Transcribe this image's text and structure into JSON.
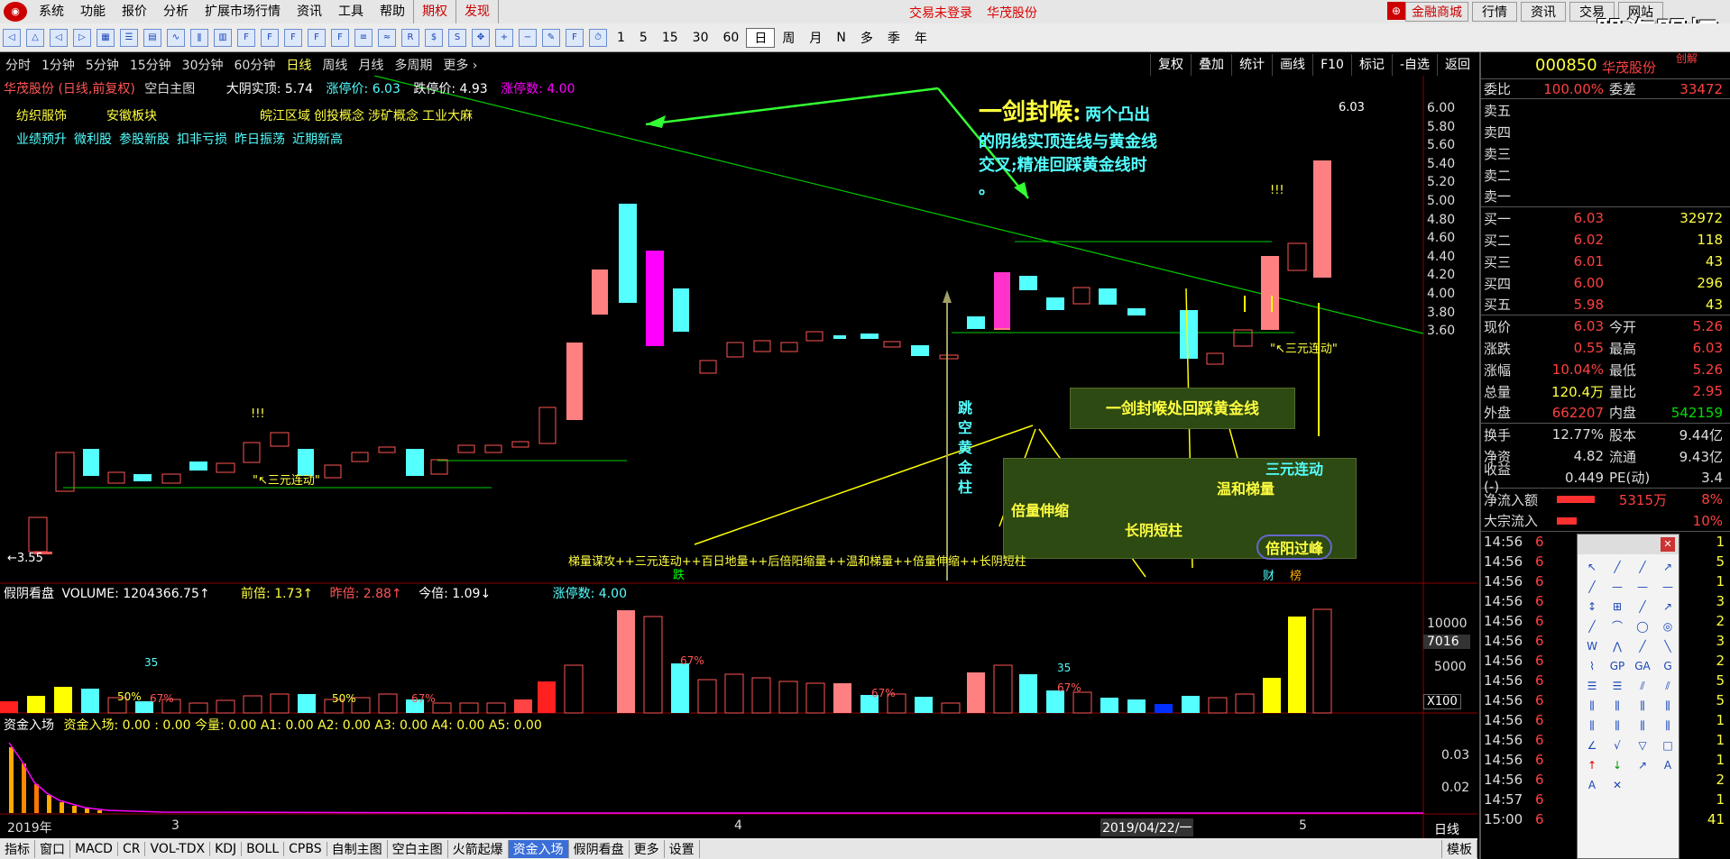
{
  "menu": {
    "items": [
      "系统",
      "功能",
      "报价",
      "分析",
      "扩展市场行情",
      "资讯",
      "工具",
      "帮助"
    ],
    "qiquan": "期权",
    "faxian": "发现",
    "status": "交易未登录",
    "stock": "华茂股份",
    "right": [
      "金融商城",
      "行情",
      "资讯",
      "交易",
      "网站"
    ],
    "watermark": "股海明灯"
  },
  "toolbar": {
    "nums": [
      "1",
      "5",
      "15",
      "30",
      "60"
    ],
    "periods": [
      "日",
      "周",
      "月",
      "N",
      "多",
      "季",
      "年"
    ]
  },
  "periodbar": {
    "items": [
      "分时",
      "1分钟",
      "5分钟",
      "15分钟",
      "30分钟",
      "60分钟",
      "日线",
      "周线",
      "月线",
      "多周期",
      "更多 ›"
    ],
    "right": [
      "复权",
      "叠加",
      "统计",
      "画线",
      "F10",
      "标记",
      "-自选",
      "返回"
    ]
  },
  "chart": {
    "title": "华茂股份 (日线,前复权)",
    "subtitle": "空白主图",
    "line2": "大阴实顶: 5.74",
    "zt": "涨停价: 6.03",
    "dt": "跌停价: 4.93",
    "ztcount": "涨停数: 4.00",
    "tags1": [
      "纺织服饰",
      "安徽板块",
      "皖江区域",
      "创投概念",
      "涉矿概念",
      "工业大麻"
    ],
    "tags2": [
      "业绩预升",
      "微利股",
      "参股新股",
      "扣非亏损",
      "昨日振荡",
      "近期新高"
    ],
    "ylabels": [
      "6.00",
      "5.80",
      "5.60",
      "5.40",
      "5.20",
      "5.00",
      "4.80",
      "4.60",
      "4.40",
      "4.20",
      "4.00",
      "3.80",
      "3.60"
    ],
    "low": "←3.55",
    "high": "6.03",
    "annot_title": "一剑封喉:",
    "annot_body1": "两个凸出",
    "annot_body2": "的阴线实顶连线与黄金线",
    "annot_body3": "交叉;精准回踩黄金线时",
    "annot_body4": "。",
    "box1": "一剑封喉处回踩黄金线",
    "box2_a": "倍量伸缩",
    "box2_b": "长阴短柱",
    "box2_c": "温和梯量",
    "box2_d": "三元连动",
    "box2_e": "倍阳过峰",
    "vert": "跳空黄金柱",
    "sanyuan": "\"↖三元连动\"",
    "sanyuan2": "\"↖三元连动\"",
    "bottomtext": "梯量谋攻++三元连动++百日地量++后倍阳缩量++温和梯量++倍量伸缩++长阴短柱",
    "die": "跌",
    "cai": "财",
    "bang": "榜",
    "exclaim": "!!!"
  },
  "volume": {
    "title": "假阴看盘",
    "label": "VOLUME: 1204366.75↑",
    "qb": "前倍: 1.73↑",
    "zb": "昨倍: 2.88↑",
    "jb": "今倍: 1.09↓",
    "ztcount": "涨停数: 4.00",
    "y1": "10000",
    "y2": "7016",
    "y3": "5000",
    "unit": "X100",
    "marks": [
      "35",
      "50%",
      "67%",
      "50%",
      "67%",
      "67%",
      "35",
      "67%",
      "67%"
    ]
  },
  "fund": {
    "title": "资金入场",
    "line": "资金入场: 0.00 : 0.00 今量: 0.00 A1: 0.00 A2: 0.00 A3: 0.00 A4: 0.00 A5: 0.00",
    "y1": "0.03",
    "y2": "0.02",
    "xlabels": [
      "2019年",
      "3",
      "4",
      "2019/04/22/一",
      "5"
    ],
    "dayline": "日线"
  },
  "bottom": {
    "tabs": [
      "指标",
      "窗口",
      "MACD",
      "CR",
      "VOL-TDX",
      "KDJ",
      "BOLL",
      "CPBS",
      "自制主图",
      "空白主图",
      "火箭起爆",
      "资金入场",
      "假阴看盘",
      "更多",
      "设置"
    ],
    "right": "模板"
  },
  "side": {
    "code": "000850",
    "name": "华茂股份",
    "tag": "创解",
    "weibi": "委比",
    "weibi_v": "100.00%",
    "weicha": "委差",
    "weicha_v": "33472",
    "sells": [
      "卖五",
      "卖四",
      "卖三",
      "卖二",
      "卖一"
    ],
    "buys": [
      [
        "买一",
        "6.03",
        "32972"
      ],
      [
        "买二",
        "6.02",
        "118"
      ],
      [
        "买三",
        "6.01",
        "43"
      ],
      [
        "买四",
        "6.00",
        "296"
      ],
      [
        "买五",
        "5.98",
        "43"
      ]
    ],
    "quote": [
      [
        "现价",
        "6.03",
        "今开",
        "5.26"
      ],
      [
        "涨跌",
        "0.55",
        "最高",
        "6.03"
      ],
      [
        "涨幅",
        "10.04%",
        "最低",
        "5.26"
      ],
      [
        "总量",
        "120.4万",
        "量比",
        "2.95"
      ],
      [
        "外盘",
        "662207",
        "内盘",
        "542159"
      ]
    ],
    "fin": [
      [
        "换手",
        "12.77%",
        "股本",
        "9.44亿"
      ],
      [
        "净资",
        "4.82",
        "流通",
        "9.43亿"
      ],
      [
        "收益(-)",
        "0.449",
        "PE(动)",
        "3.4"
      ]
    ],
    "flow": [
      [
        "净流入额",
        "5315万",
        "8%"
      ],
      [
        "大宗流入",
        "",
        "10%"
      ]
    ],
    "ticks": [
      "14:56",
      "14:56",
      "14:56",
      "14:56",
      "14:56",
      "14:56",
      "14:56",
      "14:56",
      "14:56",
      "14:56",
      "14:56",
      "14:56",
      "14:56",
      "14:57",
      "15:00"
    ],
    "tickvals": [
      "6",
      "6",
      "6",
      "6",
      "6",
      "6",
      "6",
      "6",
      "6",
      "6",
      "6",
      "6",
      "6",
      "6",
      "6"
    ],
    "ticksides": [
      "S",
      "S",
      "S",
      "S",
      "S",
      "S",
      "S",
      "S",
      "S",
      "S",
      "S",
      "S",
      "S",
      "S",
      "S"
    ],
    "ticknums": [
      "1",
      "5",
      "1",
      "3",
      "2",
      "3",
      "2",
      "5",
      "5",
      "1",
      "1",
      "1",
      "2",
      "1",
      "41"
    ]
  }
}
